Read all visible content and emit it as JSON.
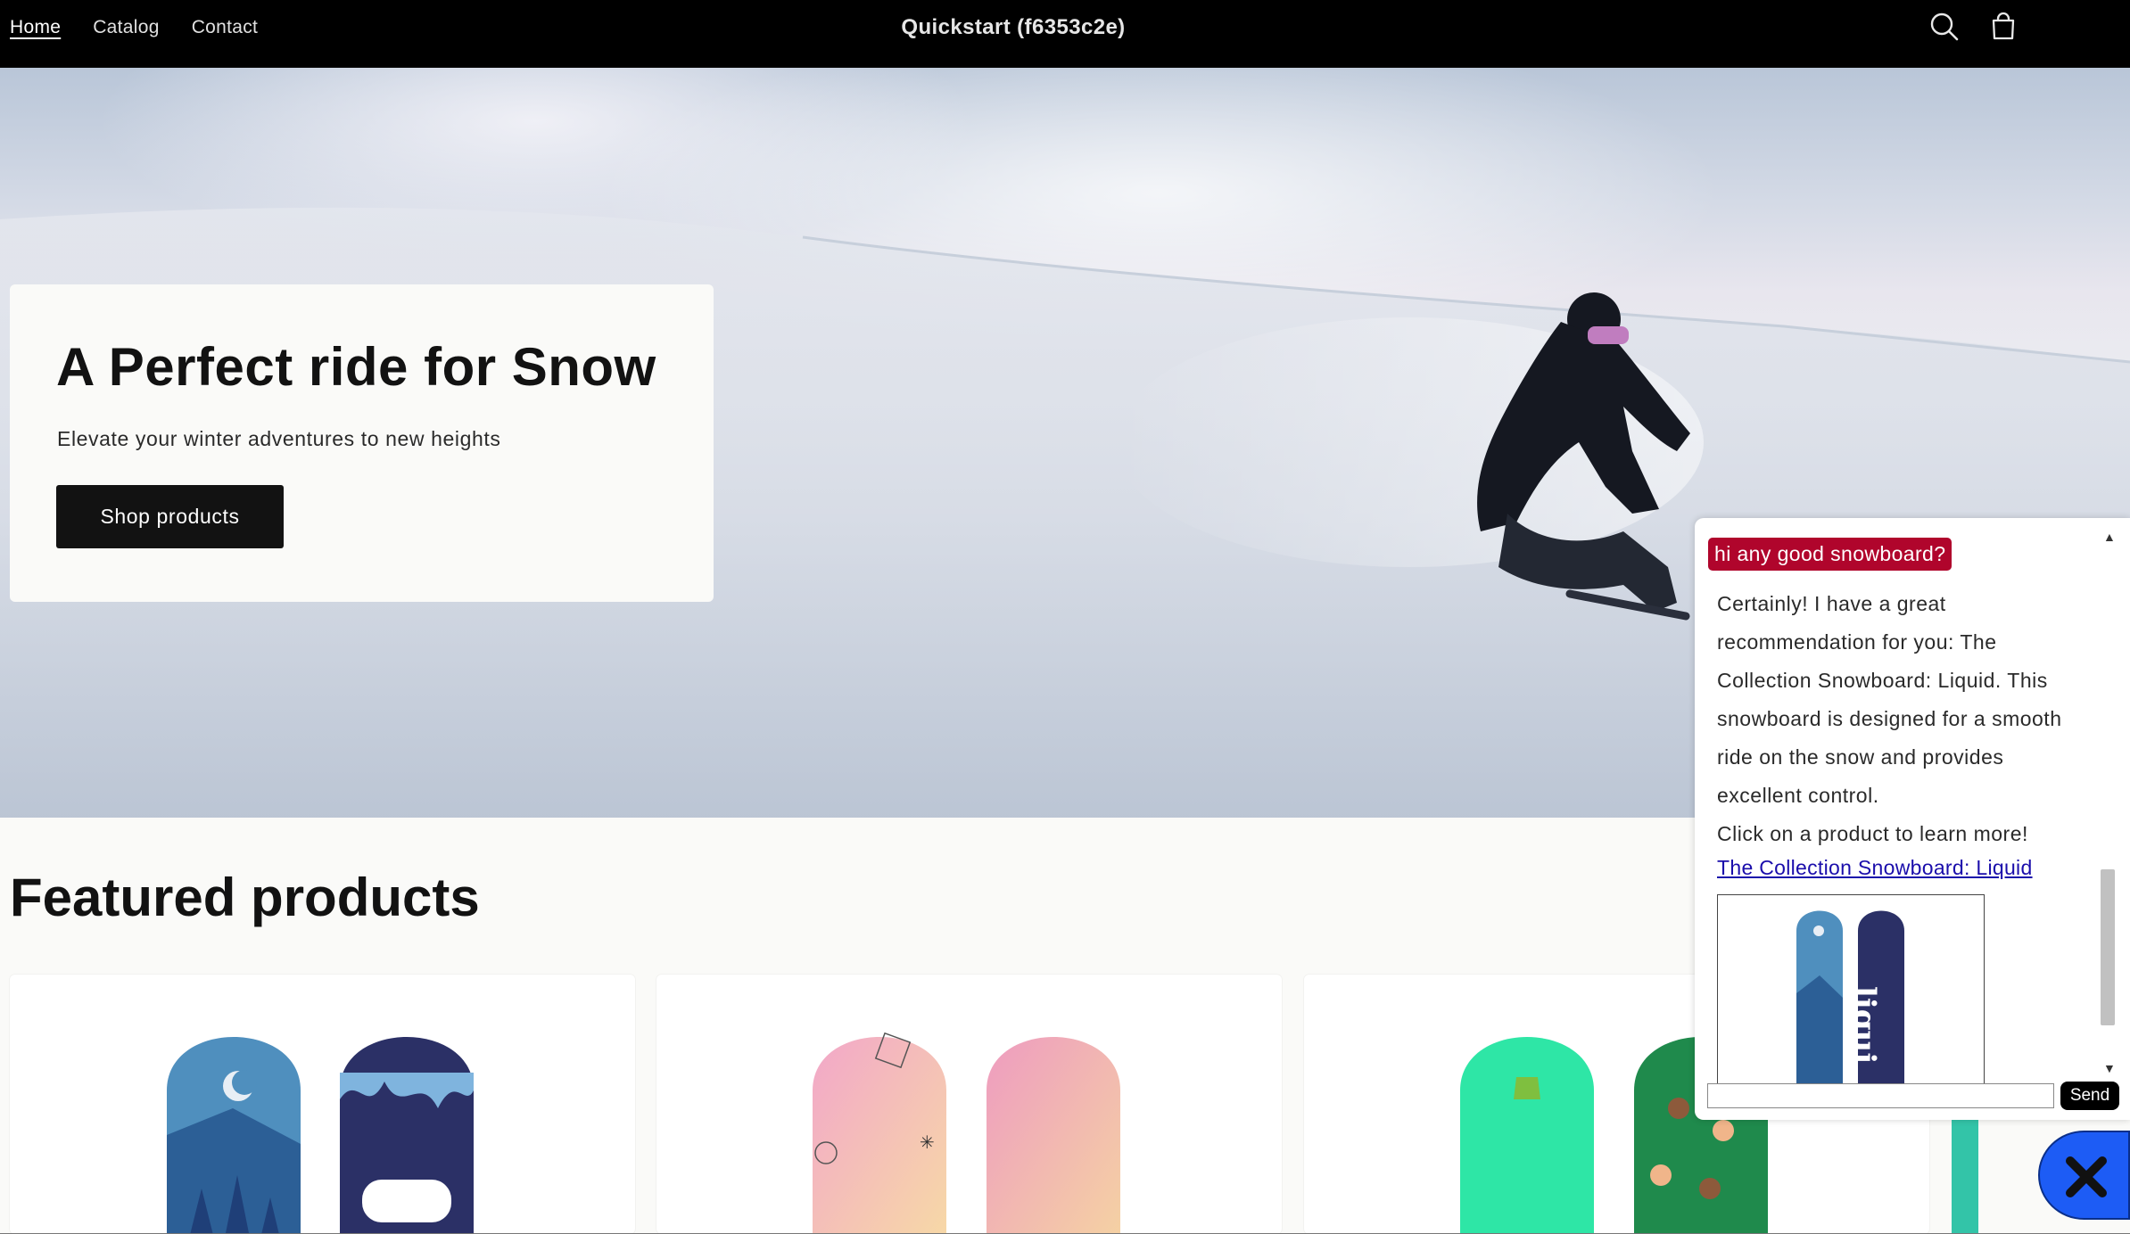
{
  "nav": {
    "items": [
      {
        "label": "Home",
        "active": true
      },
      {
        "label": "Catalog",
        "active": false
      },
      {
        "label": "Contact",
        "active": false
      }
    ],
    "brand": "Quickstart (f6353c2e)",
    "icons": {
      "search": "search-icon",
      "cart": "cart-icon"
    }
  },
  "hero": {
    "title": "A Perfect ride for Snow",
    "subtitle": "Elevate your winter adventures to new heights",
    "button_label": "Shop products"
  },
  "featured": {
    "title": "Featured products"
  },
  "chat": {
    "user_message": "hi any good snowboard?",
    "bot_lines": [
      "Certainly! I have a great recommendation for you: The Collection Snowboard: Liquid. This snowboard is designed for a smooth ride on the snow and provides excellent control.",
      "Click on a product to learn more!"
    ],
    "product_link": "The Collection Snowboard: Liquid",
    "input_value": "",
    "send_label": "Send"
  },
  "colors": {
    "topbar": "#000000",
    "user_bubble": "#b0052c",
    "link": "#1a0dab",
    "fab": "#1d5cf5"
  }
}
